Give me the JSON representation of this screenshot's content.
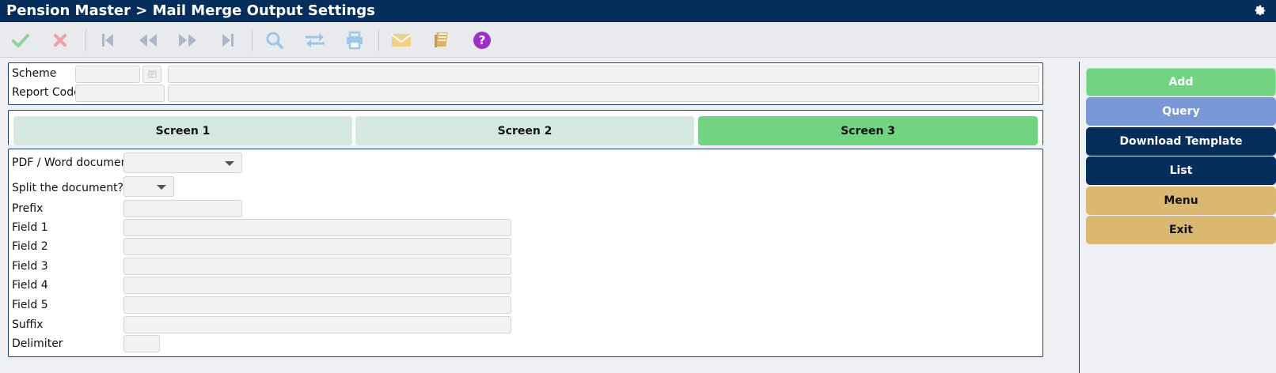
{
  "header": {
    "title": "Pension Master > Mail Merge Output Settings"
  },
  "toolbar": {
    "items": [
      "accept",
      "cancel",
      "first",
      "previous",
      "next",
      "last",
      "search",
      "swap",
      "print",
      "mail",
      "notebook",
      "help"
    ]
  },
  "form": {
    "scheme_label": "Scheme",
    "report_code_label": "Report Code",
    "scheme_value": "",
    "scheme_desc": "",
    "report_code_value": "",
    "report_code_desc": ""
  },
  "tabs": [
    {
      "label": "Screen 1",
      "active": false
    },
    {
      "label": "Screen 2",
      "active": false
    },
    {
      "label": "Screen 3",
      "active": true
    }
  ],
  "screen3": {
    "pdf_word_label": "PDF / Word document",
    "pdf_word_value": "",
    "split_label": "Split the document?",
    "split_value": "",
    "prefix_label": "Prefix",
    "field1_label": "Field 1",
    "field2_label": "Field 2",
    "field3_label": "Field 3",
    "field4_label": "Field 4",
    "field5_label": "Field 5",
    "suffix_label": "Suffix",
    "delimiter_label": "Delimiter"
  },
  "side_buttons": {
    "add": "Add",
    "query": "Query",
    "download_template": "Download Template",
    "list": "List",
    "menu": "Menu",
    "exit": "Exit"
  },
  "colors": {
    "header_bg": "#062e5d",
    "add_bg": "#72d482",
    "query_bg": "#7a98d6",
    "navy_btn": "#062e5d",
    "tan_btn": "#dbb872",
    "tab_active": "#72d482",
    "tab_inactive": "#d5e8df"
  }
}
